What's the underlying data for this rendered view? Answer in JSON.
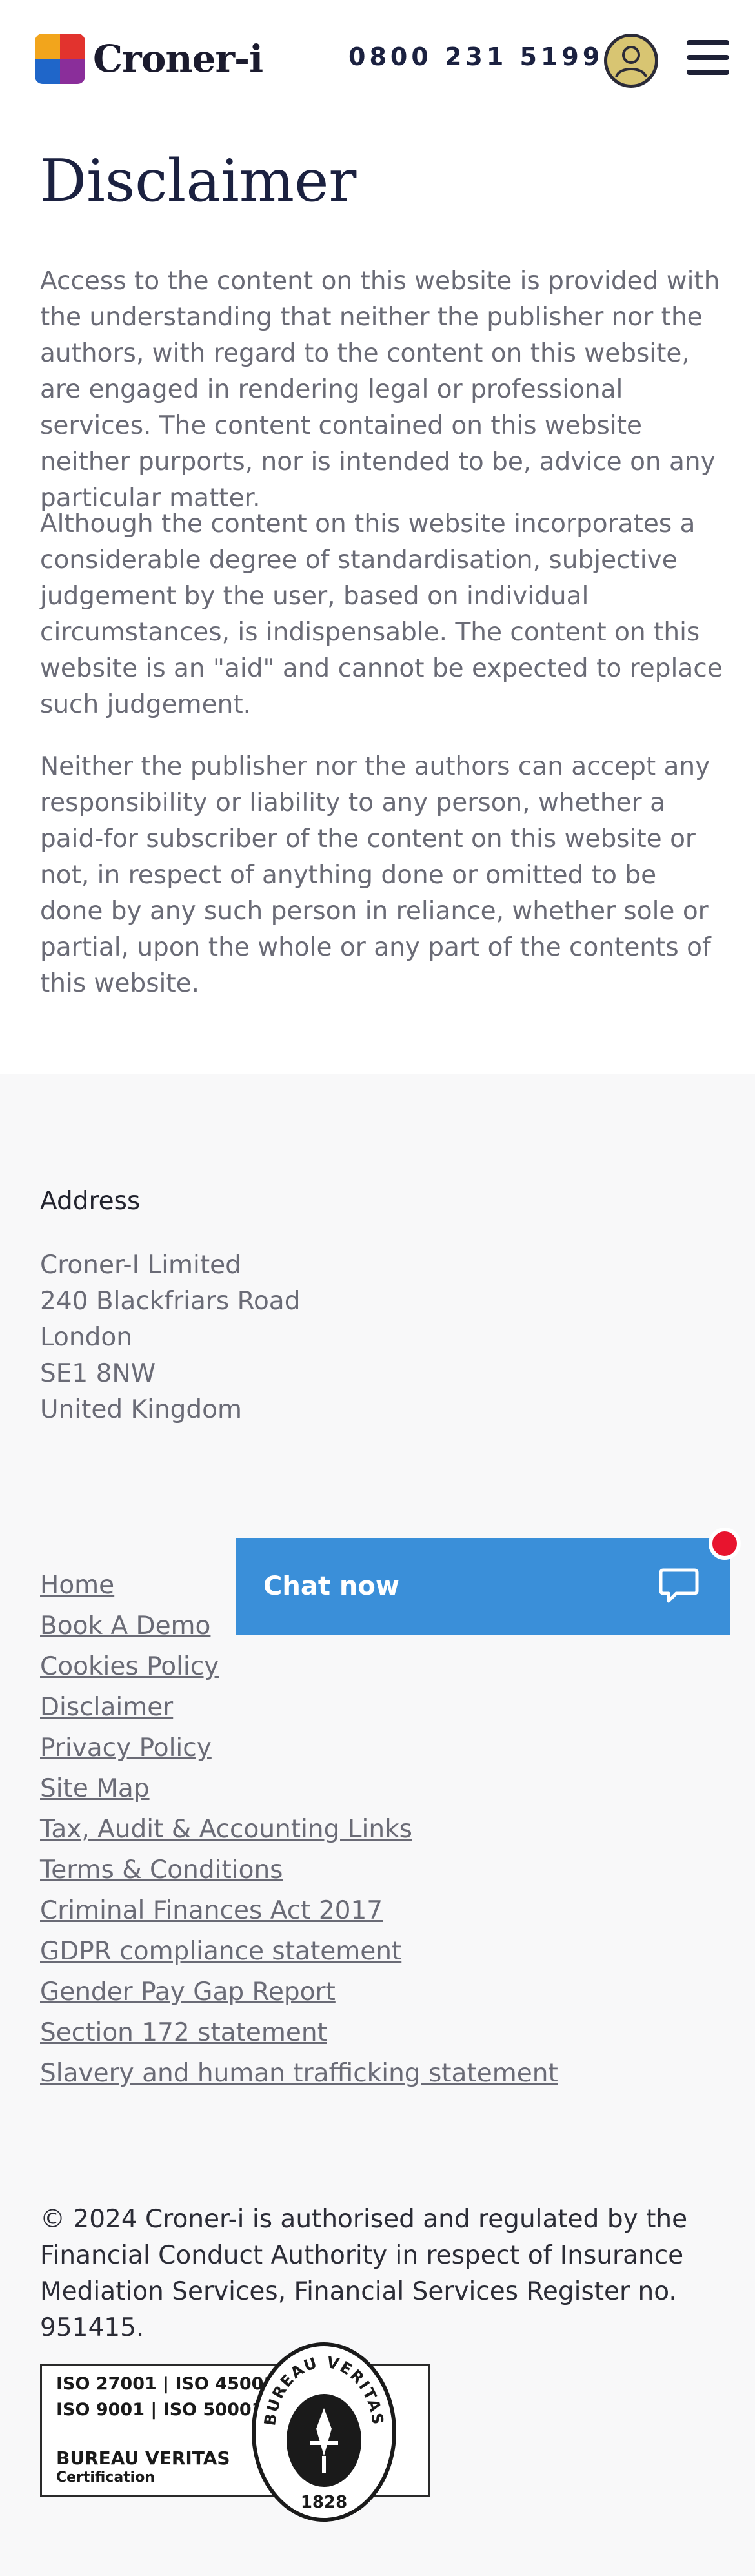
{
  "header": {
    "logo_text": "Croner-i",
    "phone": "0800 231 5199"
  },
  "main": {
    "title": "Disclaimer",
    "paragraphs": [
      "Access to the content on this website is provided with the understanding that neither the publisher nor the authors, with regard to the content on this website, are engaged in rendering legal or professional services. The content contained on this website neither purports, nor is intended to be, advice on any particular matter.",
      "Although the content on this website incorporates a considerable degree of standardisation, subjective judgement by the user, based on individual circumstances, is indispensable. The content on this website is an \"aid\" and cannot be expected to replace such judgement.",
      "Neither the publisher nor the authors can accept any responsibility or liability to any person, whether a paid-for subscriber of the content on this website or not, in respect of anything done or omitted to be done by any such person in reliance, whether sole or partial, upon the whole or any part of the contents of this website."
    ]
  },
  "footer": {
    "address_heading": "Address",
    "address_lines": [
      "Croner-I Limited",
      "240 Blackfriars Road",
      "London",
      "SE1 8NW",
      "United Kingdom"
    ],
    "links": [
      "Home",
      "Book A Demo",
      "Cookies Policy",
      "Disclaimer",
      "Privacy Policy",
      "Site Map",
      "Tax, Audit & Accounting Links",
      "Terms & Conditions",
      "Criminal Finances Act 2017",
      "GDPR compliance statement",
      "Gender Pay Gap Report",
      "Section 172 statement",
      "Slavery and human trafficking statement"
    ],
    "legal": "© 2024 Croner-i is authorised and regulated by the Financial Conduct Authority in respect of Insurance Mediation Services, Financial Services Register no. 951415.",
    "cert": {
      "line1": "ISO 27001 | ISO 45001",
      "line2": "ISO 9001 | ISO 50001",
      "line3": "BUREAU VERITAS",
      "line4": "Certification",
      "seal_top": "BUREAU VERITAS",
      "seal_year": "1828"
    }
  },
  "chat": {
    "label": "Chat now"
  },
  "colors": {
    "chat_blue": "#3a8fd9",
    "notification_red": "#e8142e",
    "title_navy": "#1b2140",
    "footer_bg": "#f8f8f9"
  },
  "icons": [
    "croner-logo-icon",
    "user-avatar-icon",
    "menu-icon",
    "chat-bubble-icon"
  ]
}
